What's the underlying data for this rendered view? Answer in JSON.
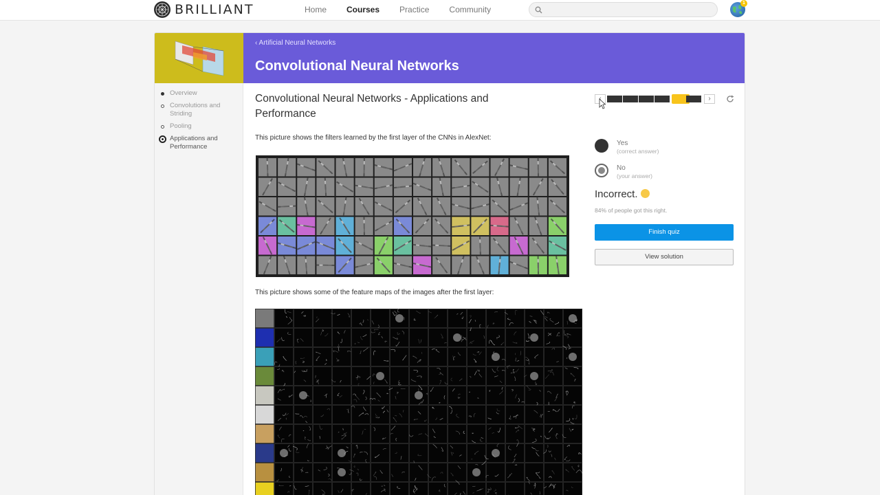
{
  "brand": {
    "name": "BRILLIANT"
  },
  "nav": {
    "links": [
      {
        "label": "Home",
        "active": false
      },
      {
        "label": "Courses",
        "active": true
      },
      {
        "label": "Practice",
        "active": false
      },
      {
        "label": "Community",
        "active": false
      }
    ],
    "search_placeholder": "",
    "notification_count": "1"
  },
  "course": {
    "breadcrumb": "‹ Artificial Neural Networks",
    "title": "Convolutional Neural Networks",
    "banner_color": "#6a5bd9",
    "thumb_color": "#cdbc1c"
  },
  "sidebar": {
    "items": [
      {
        "label": "Overview",
        "state": "done"
      },
      {
        "label": "Convolutions and Striding",
        "state": "open"
      },
      {
        "label": "Pooling",
        "state": "open"
      },
      {
        "label": "Applications and Performance",
        "state": "current"
      }
    ]
  },
  "lesson": {
    "title": "Convolutional Neural Networks - Applications and Performance",
    "para1": "This picture shows the filters learned by the first layer of the CNNs in AlexNet:",
    "para2": "This picture shows some of the feature maps of the images after the first layer:",
    "filters_image": {
      "cols": 16,
      "rows": 6
    },
    "feature_maps_image": {
      "cols": 17,
      "rows": 10
    }
  },
  "quiz": {
    "progress": {
      "segments": 6,
      "current": 5
    },
    "choices": [
      {
        "label": "Yes",
        "sub": "(correct answer)",
        "style": "filled"
      },
      {
        "label": "No",
        "sub": "(your answer)",
        "style": "selected"
      }
    ],
    "result": "Incorrect.",
    "stat": "84% of people got this right.",
    "finish_label": "Finish quiz",
    "solution_label": "View solution",
    "primary_color": "#0b93e6",
    "progress_color": "#f8c41c"
  }
}
